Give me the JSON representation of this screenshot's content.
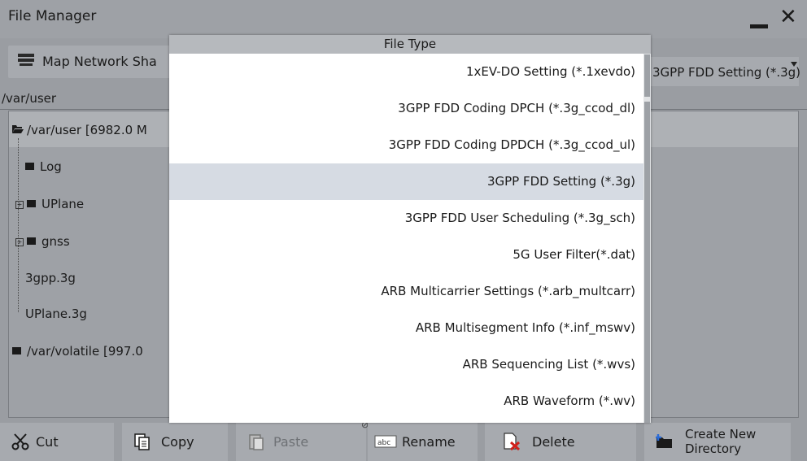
{
  "window": {
    "title": "File Manager"
  },
  "toolbar": {
    "map_network_label": "Map Network Sha"
  },
  "path": "/var/user",
  "file_type_selector": {
    "value": "3GPP FDD Setting (*.3g)"
  },
  "tree": {
    "root_label": "/var/user  [6982.0 M",
    "items": [
      {
        "label": "Log",
        "type": "folder"
      },
      {
        "label": "UPlane",
        "type": "folder"
      },
      {
        "label": "gnss",
        "type": "folder"
      },
      {
        "label": "3gpp.3g",
        "type": "file"
      },
      {
        "label": "UPlane.3g",
        "type": "file"
      }
    ],
    "volatile_label": "/var/volatile  [997.0"
  },
  "dialog": {
    "title": "File Type",
    "items": [
      "1xEV-DO Setting (*.1xevdo)",
      "3GPP FDD Coding DPCH (*.3g_ccod_dl)",
      "3GPP FDD Coding DPDCH (*.3g_ccod_ul)",
      "3GPP FDD Setting (*.3g)",
      "3GPP FDD User Scheduling (*.3g_sch)",
      "5G User Filter(*.dat)",
      "ARB Multicarrier Settings (*.arb_multcarr)",
      "ARB Multisegment Info (*.inf_mswv)",
      "ARB Sequencing List (*.wvs)",
      "ARB Waveform (*.wv)"
    ],
    "selected_index": 3
  },
  "bottom": {
    "cut": "Cut",
    "copy": "Copy",
    "paste": "Paste",
    "rename": "Rename",
    "delete": "Delete",
    "create_new_line1": "Create New",
    "create_new_line2": "Directory"
  },
  "colors": {
    "selection": "#d6dbe3",
    "dialog_header": "#b6b9bd",
    "background": "#9ea1a6"
  }
}
